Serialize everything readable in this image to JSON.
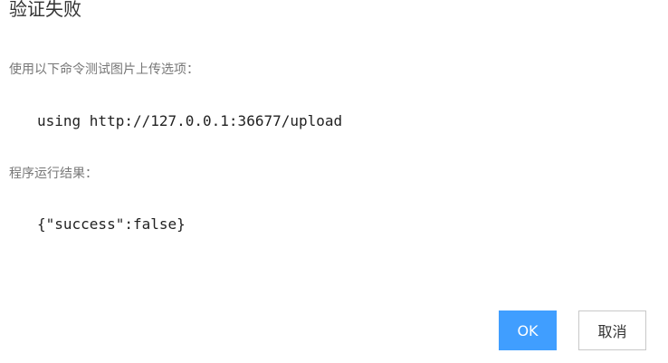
{
  "dialog": {
    "title": "验证失败",
    "command_label": "使用以下命令测试图片上传选项：",
    "command": "using http://127.0.0.1:36677/upload",
    "result_label": "程序运行结果：",
    "result": "{\"success\":false}",
    "ok_label": "OK",
    "cancel_label": "取消"
  },
  "colors": {
    "primary": "#409eff",
    "title_text": "#333333",
    "label_text": "#777777",
    "button_border": "#c8c8c8"
  }
}
